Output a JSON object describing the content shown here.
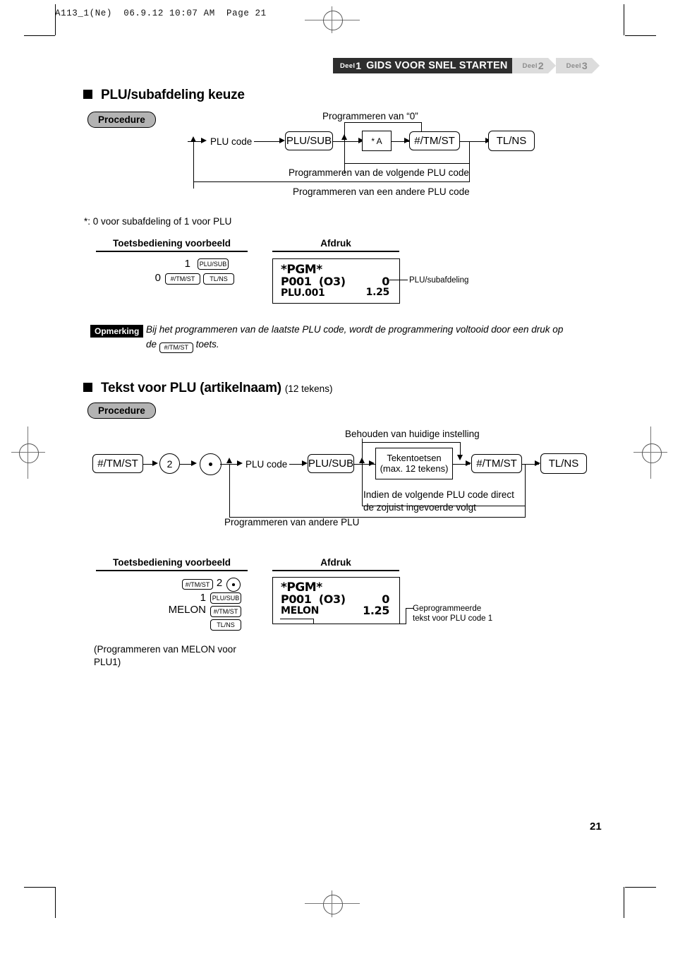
{
  "file_header": "A113_1(Ne)  06.9.12 10:07 AM  Page 21",
  "banner": {
    "deel_label": "Deel",
    "part_number": "1",
    "title": "GIDS VOOR SNEL STARTEN",
    "tab2_label": "Deel",
    "tab2_number": "2",
    "tab3_label": "Deel",
    "tab3_number": "3"
  },
  "section1": {
    "heading": "PLU/subafdeling keuze",
    "procedure_label": "Procedure",
    "diagram": {
      "top_label": "Programmeren van “0”",
      "plu_code": "PLU code",
      "key_plusub": "PLU/SUB",
      "key_star_a": "* A",
      "key_tmst": "#/TM/ST",
      "key_tlns": "TL/NS",
      "loop_next": "Programmeren van de volgende PLU code",
      "loop_other": "Programmeren van een andere PLU code"
    },
    "footnote": "*: 0 voor subafdeling of 1 voor PLU",
    "col_keyop": "Toetsbediening voorbeeld",
    "col_print": "Afdruk",
    "keyop": {
      "row1_num": "1",
      "row1_key": "PLU/SUB",
      "row2_num": "0",
      "row2_key1": "#/TM/ST",
      "row2_key2": "TL/NS"
    },
    "receipt": {
      "line1": "*PGM*",
      "line2_left": "P001  (O3)",
      "line2_right": "0",
      "line3_left": "PLU.001",
      "line3_right": "1.25"
    },
    "callout": "PLU/subafdeling"
  },
  "note": {
    "tag": "Opmerking",
    "text_part1": "Bij het programmeren van de laatste PLU code, wordt de programmering voltooid door een druk op",
    "text_part2": "de",
    "inline_key": "#/TM/ST",
    "text_part3": "toets."
  },
  "section2": {
    "heading": "Tekst voor PLU (artikelnaam)",
    "heading_sub": "(12 tekens)",
    "procedure_label": "Procedure",
    "diagram": {
      "key_tmst_1": "#/TM/ST",
      "key_two": "2",
      "key_dot": "dot-key",
      "plu_code": "PLU code",
      "key_plusub": "PLU/SUB",
      "charkeys_line1": "Tekentoetsen",
      "charkeys_line2": "(max. 12 tekens)",
      "key_tmst_2": "#/TM/ST",
      "key_tlns": "TL/NS",
      "top_label": "Behouden van huidige instelling",
      "mid_label_line1": "Indien de volgende PLU code direct",
      "mid_label_line2": "de zojuist ingevoerde volgt",
      "bottom_label": "Programmeren van andere PLU"
    },
    "col_keyop": "Toetsbediening voorbeeld",
    "col_print": "Afdruk",
    "keyop": {
      "row1_key": "#/TM/ST",
      "row1_num": "2",
      "row1_dot": "dot-key",
      "row2_num": "1",
      "row2_key": "PLU/SUB",
      "row3_word": "MELON",
      "row3_key": "#/TM/ST",
      "row4_key": "TL/NS"
    },
    "receipt": {
      "line1": "*PGM*",
      "line2_left": "P001  (O3)",
      "line2_right": "0",
      "line3_left": "MELON",
      "line3_right": "1.25"
    },
    "callout_line1": "Geprogrammeerde",
    "callout_line2": "tekst voor PLU code 1",
    "bottom_note_line1": "(Programmeren van MELON voor",
    "bottom_note_line2": "PLU1)"
  },
  "page_number": "21"
}
